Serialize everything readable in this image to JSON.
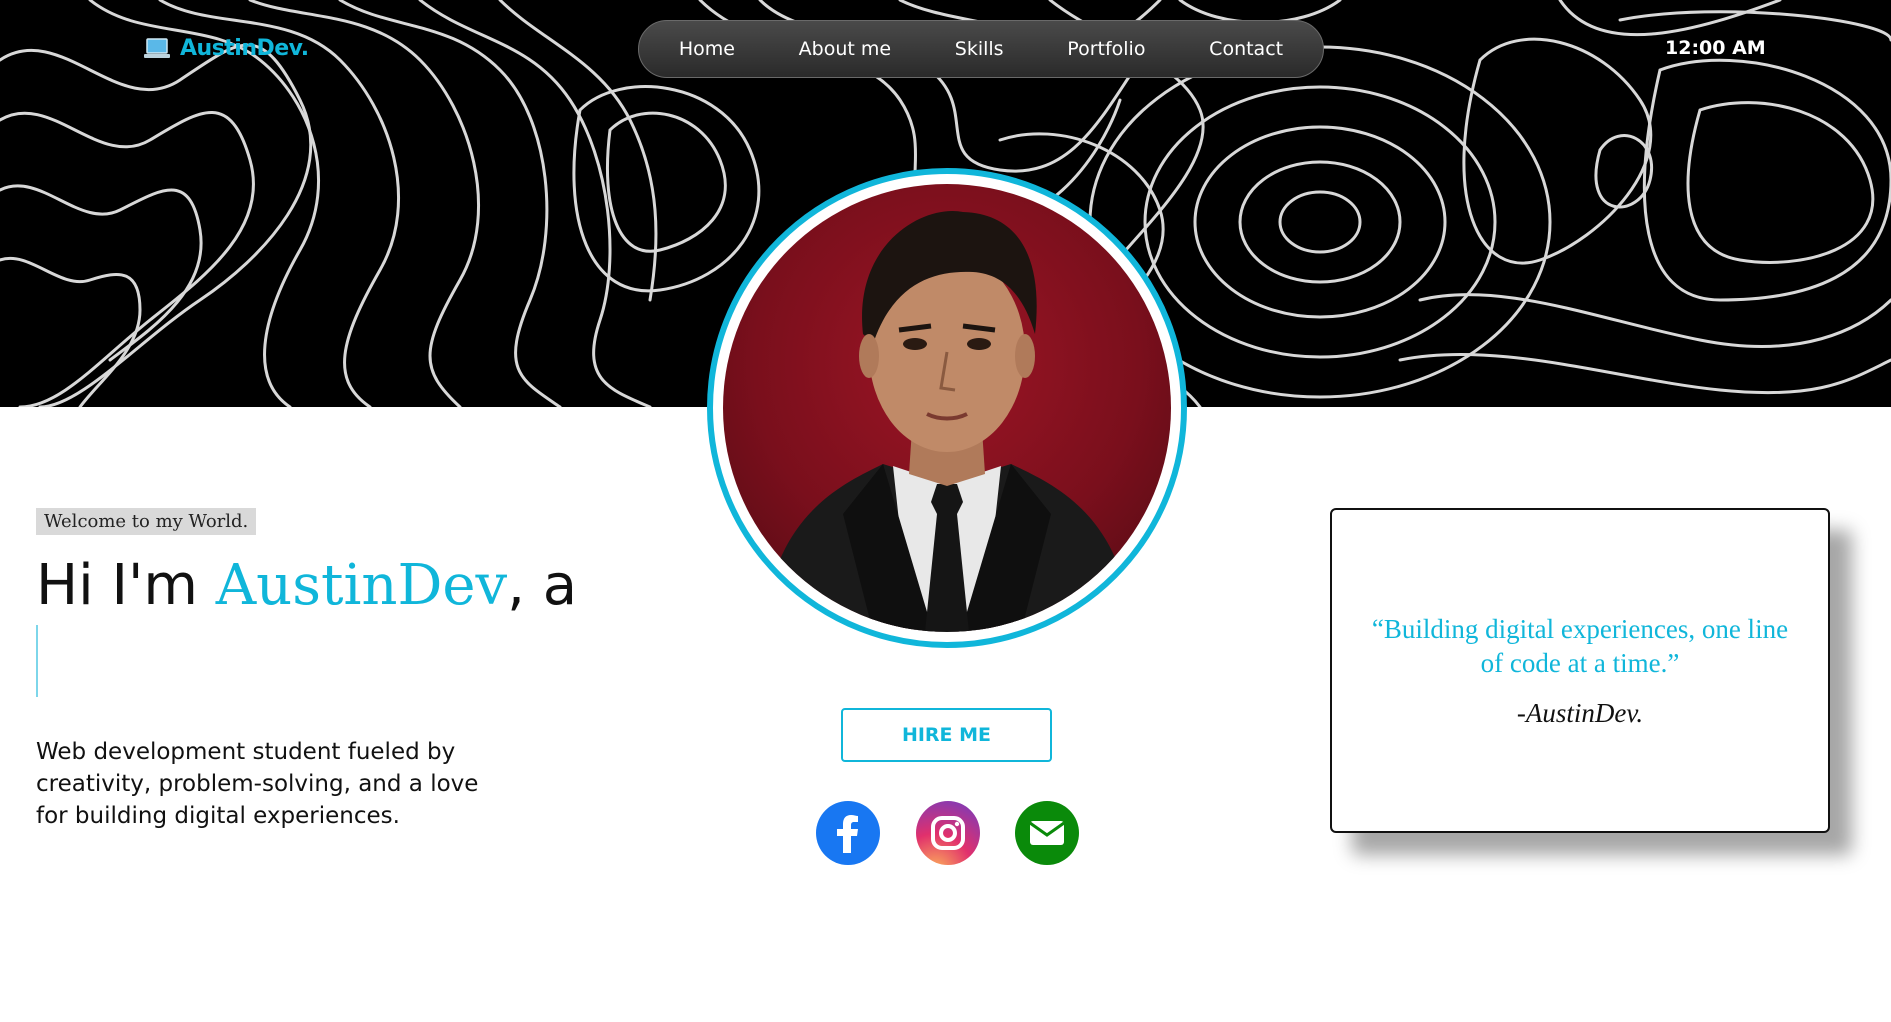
{
  "brand": {
    "name": "AustinDev.",
    "icon": "laptop-icon",
    "color": "#10b6da"
  },
  "nav": {
    "items": [
      {
        "label": "Home"
      },
      {
        "label": "About me"
      },
      {
        "label": "Skills"
      },
      {
        "label": "Portfolio"
      },
      {
        "label": "Contact"
      }
    ]
  },
  "clock": "12:00 AM",
  "hero": {
    "welcome": "Welcome to my World.",
    "greeting_prefix": "Hi I'm ",
    "greeting_name": "AustinDev",
    "greeting_suffix": ", a",
    "bio": "Web development student fueled by creativity, problem-solving, and a love for building digital experiences.",
    "hire_label": "HIRE ME"
  },
  "social": [
    {
      "name": "facebook",
      "icon": "facebook-icon",
      "color": "#1877f2"
    },
    {
      "name": "instagram",
      "icon": "instagram-icon",
      "color": "#c13584"
    },
    {
      "name": "email",
      "icon": "mail-icon",
      "color": "#0a8a0a"
    }
  ],
  "quote": {
    "text": "“Building digital experiences, one line of code at a time.”",
    "author": "-AustinDev."
  },
  "colors": {
    "accent": "#10b6da",
    "hero_bg": "#000000"
  }
}
